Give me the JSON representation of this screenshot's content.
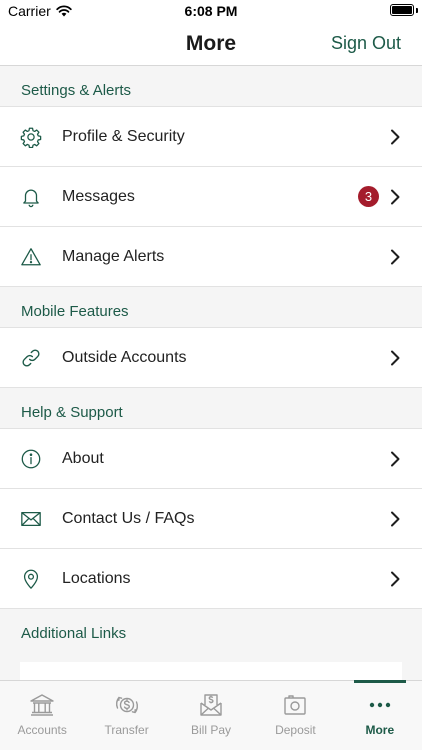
{
  "status_bar": {
    "carrier": "Carrier",
    "time": "6:08 PM"
  },
  "header": {
    "title": "More",
    "action_label": "Sign Out"
  },
  "sections": [
    {
      "title": "Settings & Alerts",
      "items": [
        {
          "label": "Profile & Security",
          "icon": "gear-icon"
        },
        {
          "label": "Messages",
          "icon": "bell-icon",
          "badge": "3"
        },
        {
          "label": "Manage Alerts",
          "icon": "warning-icon"
        }
      ]
    },
    {
      "title": "Mobile Features",
      "items": [
        {
          "label": "Outside Accounts",
          "icon": "link-icon"
        }
      ]
    },
    {
      "title": "Help & Support",
      "items": [
        {
          "label": "About",
          "icon": "info-icon"
        },
        {
          "label": "Contact Us / FAQs",
          "icon": "envelope-icon"
        },
        {
          "label": "Locations",
          "icon": "location-pin-icon"
        }
      ]
    },
    {
      "title": "Additional Links",
      "items": []
    }
  ],
  "tabs": [
    {
      "label": "Accounts",
      "icon": "bank-icon",
      "active": false
    },
    {
      "label": "Transfer",
      "icon": "transfer-dollar-icon",
      "active": false
    },
    {
      "label": "Bill Pay",
      "icon": "bill-pay-icon",
      "active": false
    },
    {
      "label": "Deposit",
      "icon": "camera-deposit-icon",
      "active": false
    },
    {
      "label": "More",
      "icon": "more-dots-icon",
      "active": true
    }
  ],
  "colors": {
    "accent": "#1d5a48",
    "badge": "#a41c2c",
    "inactive_tab": "#9a9a9a"
  }
}
